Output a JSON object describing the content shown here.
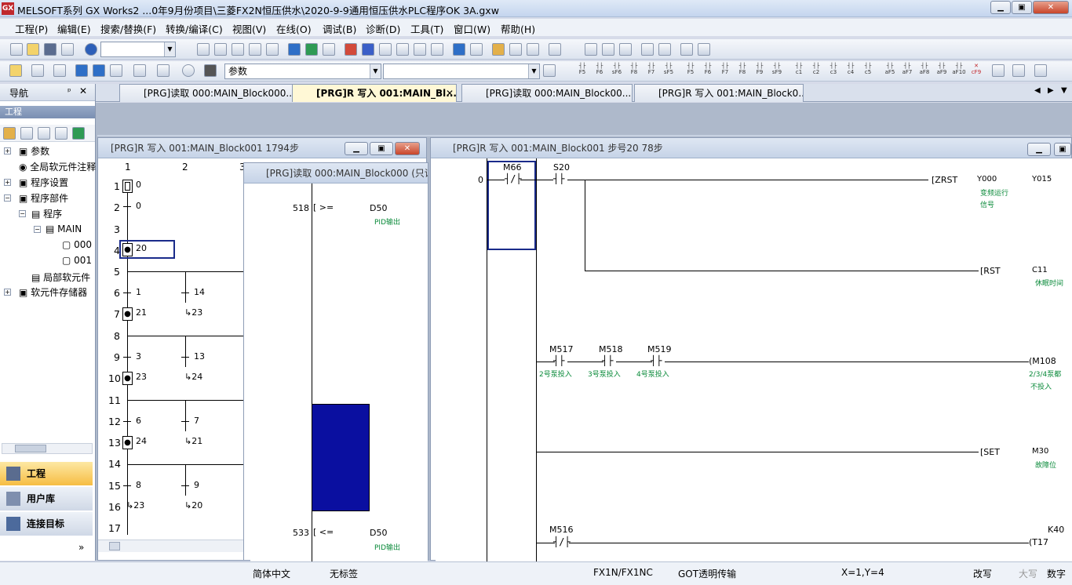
{
  "title": "MELSOFT系列 GX Works2 ...0年9月份项目\\三菱FX2N恒压供水\\2020-9-9通用恒压供水PLC程序OK 3A.gxw",
  "menu": [
    "工程(P)",
    "编辑(E)",
    "搜索/替换(F)",
    "转换/编译(C)",
    "视图(V)",
    "在线(O)",
    "调试(B)",
    "诊断(D)",
    "工具(T)",
    "窗口(W)",
    "帮助(H)"
  ],
  "toolbar": {
    "combo2_value": "参数"
  },
  "nav": {
    "title": "导航",
    "section": "工程",
    "tree": [
      "参数",
      "全局软元件注释",
      "程序设置",
      "程序部件",
      "程序",
      "MAIN",
      "000",
      "001",
      "局部软元件",
      "软元件存储器"
    ],
    "buttons": [
      "工程",
      "用户库",
      "连接目标"
    ],
    "more": "»"
  },
  "tabs": [
    "[PRG]读取 000:MAIN_Block000...",
    "[PRG]R 写入 001:MAIN_Bl...",
    "[PRG]读取 000:MAIN_Block00...",
    "[PRG]R 写入 001:MAIN_Block0..."
  ],
  "sfc": {
    "title": "[PRG]R 写入 001:MAIN_Block001 1794步",
    "cols": [
      "1",
      "2",
      "3"
    ],
    "rows": [
      "1",
      "2",
      "3",
      "4",
      "5",
      "6",
      "7",
      "8",
      "9",
      "10",
      "11",
      "12",
      "13",
      "14",
      "15",
      "16",
      "17"
    ],
    "c1": [
      "0",
      "0",
      "20",
      "1",
      "21",
      "3",
      "23",
      "6",
      "24",
      "8",
      "23"
    ],
    "c2": [
      "14",
      "23",
      "13",
      "24",
      "7",
      "21",
      "9",
      "20"
    ]
  },
  "read": {
    "title": "[PRG]读取 000:MAIN_Block000 (只读",
    "step1": "518",
    "op1": ">=",
    "dev1": "D50",
    "cmt1": "PID输出",
    "step2": "533",
    "op2": "<=",
    "dev2": "D50",
    "cmt2": "PID输出"
  },
  "ladder": {
    "title": "[PRG]R 写入 001:MAIN_Block001 步号20 78步",
    "step0": "0",
    "m66": "M66",
    "s20": "S20",
    "zrst": "ZRST",
    "y000": "Y000",
    "y015": "Y015",
    "zrst_cmt1": "变频运行",
    "zrst_cmt2": "信号",
    "rst": "RST",
    "c11": "C11",
    "c11_cmt": "休眠时间",
    "m517": "M517",
    "m518": "M518",
    "m519": "M519",
    "m517_cmt": "2号泵投入",
    "m518_cmt": "3号泵投入",
    "m519_cmt": "4号泵投入",
    "m108": "M108",
    "m108_cmt1": "2/3/4泵都",
    "m108_cmt2": "不投入",
    "set": "SET",
    "m30": "M30",
    "m30_cmt": "故障位",
    "m516": "M516",
    "k40": "K40",
    "t17": "T17"
  },
  "status": {
    "lang": "简体中文",
    "label": "无标签",
    "cpu": "FX1N/FX1NC",
    "conn": "GOT透明传输",
    "pos": "X=1,Y=4",
    "mode": "改写",
    "caps": "大写",
    "num": "数字"
  }
}
